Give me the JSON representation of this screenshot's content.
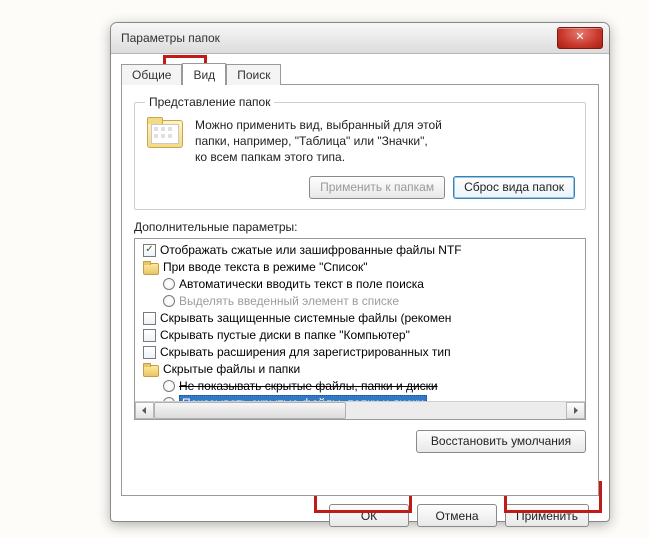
{
  "window": {
    "title": "Параметры папок"
  },
  "tabs": {
    "general": "Общие",
    "view": "Вид",
    "search": "Поиск"
  },
  "group": {
    "legend": "Представление папок",
    "text_l1": "Можно применить вид, выбранный для этой",
    "text_l2": "папки, например, \"Таблица\" или \"Значки\",",
    "text_l3": "ко всем папкам этого типа.",
    "apply": "Применить к папкам",
    "reset": "Сброс вида папок"
  },
  "adv_label": "Дополнительные параметры:",
  "tree": {
    "r1": "Отображать сжатые или зашифрованные файлы NTF",
    "r2": "При вводе текста в режиме \"Список\"",
    "r3": "Автоматически вводить текст в поле поиска",
    "r4": "Выделять введенный элемент в списке",
    "r5": "Скрывать защищенные системные файлы (рекомен",
    "r6": "Скрывать пустые диски в папке \"Компьютер\"",
    "r7": "Скрывать расширения для зарегистрированных тип",
    "r8": "Скрытые файлы и папки",
    "r9": "Не показывать скрытые файлы, папки и диски",
    "r10": "Показывать скрытые файлы, папки и диски"
  },
  "restore": "Восстановить умолчания",
  "buttons": {
    "ok": "ОК",
    "cancel": "Отмена",
    "apply": "Применить"
  }
}
